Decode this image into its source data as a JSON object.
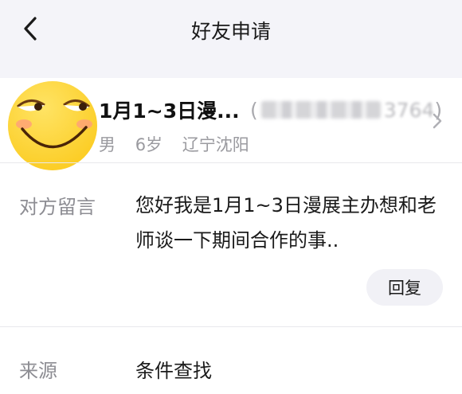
{
  "header": {
    "title": "好友申请",
    "back_icon": "chevron-left-icon"
  },
  "profile": {
    "avatar_icon": "smirking-face-emoji",
    "name": "1月1~3日漫...",
    "id_open": "(",
    "id_visible_suffix": "3764",
    "id_close": ")",
    "gender": "男",
    "age": "6岁",
    "location": "辽宁沈阳",
    "chevron_icon": "chevron-right-icon"
  },
  "message": {
    "label": "对方留言",
    "text": "您好我是1月1~3日漫展主办想和老师谈一下期间合作的事..",
    "reply_label": "回复"
  },
  "source": {
    "label": "来源",
    "value": "条件查找"
  },
  "colors": {
    "nav_bg": "#f4f4f9",
    "label_gray": "#8d8d93",
    "reply_bg": "#f1f1f6",
    "avatar_yellow": "#ffd93b"
  }
}
